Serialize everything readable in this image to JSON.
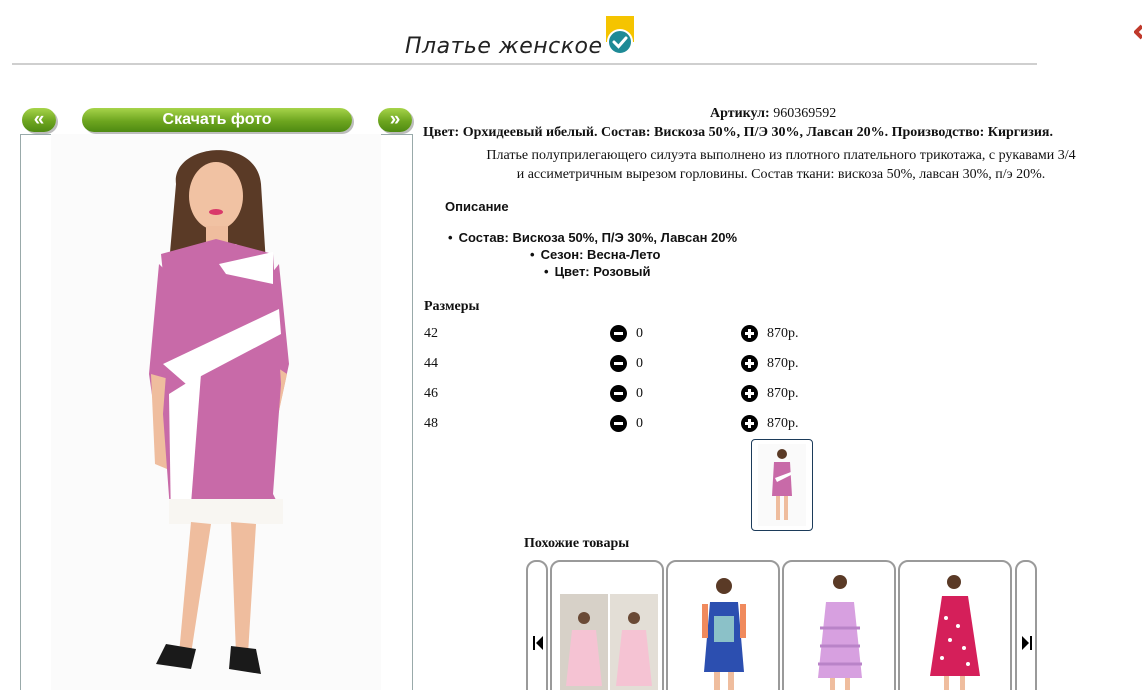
{
  "header": {
    "title": "Платье женское"
  },
  "gallery": {
    "prev_label": "«",
    "download_label": "Скачать фото",
    "next_label": "»"
  },
  "product": {
    "article_label": "Артикул:",
    "article_value": "960369592",
    "color_line": "Цвет: Орхидеевый ибелый. Состав: Вискоза 50%, П/Э 30%, Лавсан 20%. Производство: Киргизия.",
    "description_line1": "Платье полуприлегающего силуэта выполнено из плотного плательного трикотажа, с рукавами 3/4",
    "description_line2": "и ассиметричным вырезом горловины. Состав ткани: вискоза 50%, лавсан 30%, п/э 20%.",
    "description_heading": "Описание",
    "properties": [
      "Состав: Вискоза 50%, П/Э 30%, Лавсан 20%",
      "Сезон: Весна-Лето",
      "Цвет: Розовый"
    ]
  },
  "sizes": {
    "heading": "Размеры",
    "rows": [
      {
        "size": "42",
        "qty": "0",
        "price": "870р."
      },
      {
        "size": "44",
        "qty": "0",
        "price": "870р."
      },
      {
        "size": "46",
        "qty": "0",
        "price": "870р."
      },
      {
        "size": "48",
        "qty": "0",
        "price": "870р."
      }
    ]
  },
  "similar": {
    "heading": "Похожие товары"
  },
  "colors": {
    "accent_green": "#6da51f",
    "dress_pink": "#c86aa8",
    "badge_yellow": "#f5c400",
    "badge_teal": "#1e8a96"
  }
}
